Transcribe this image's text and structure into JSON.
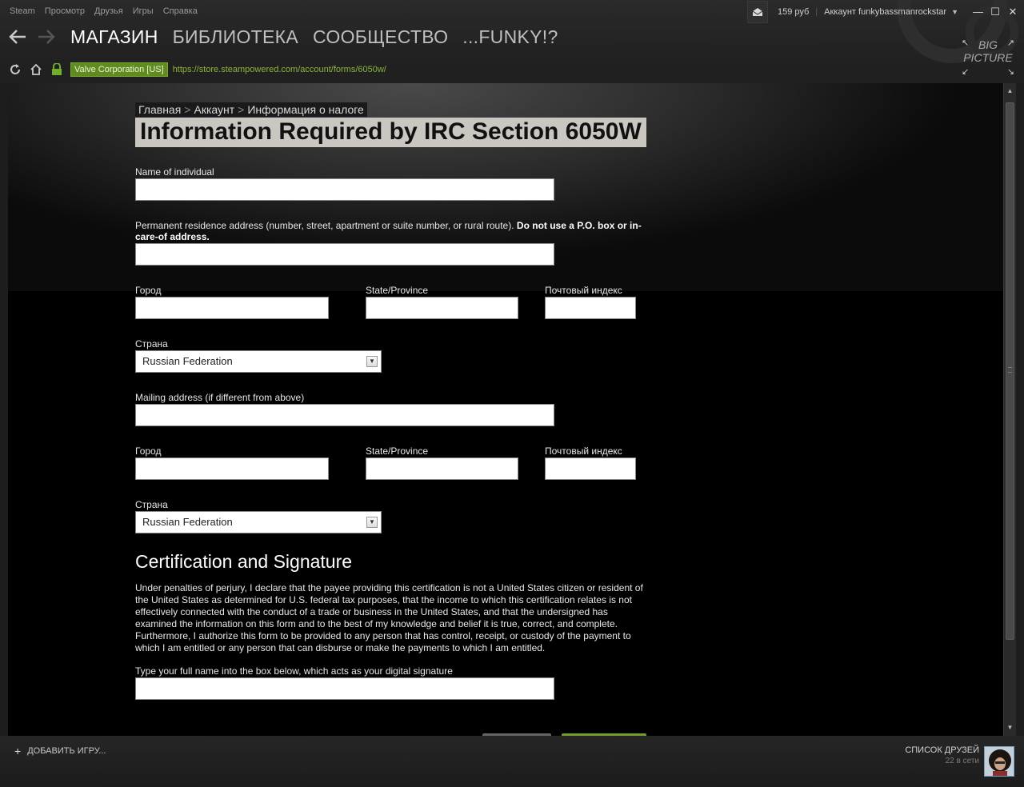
{
  "menu": [
    "Steam",
    "Просмотр",
    "Друзья",
    "Игры",
    "Справка"
  ],
  "wallet": "159 руб",
  "separator": "|",
  "account": "Аккаунт funkybassmanrockstar",
  "nav": [
    "МАГАЗИН",
    "БИБЛИОТЕКА",
    "СООБЩЕСТВО",
    "...FUNKY!?"
  ],
  "big_picture": {
    "line1": "BIG",
    "line2": "PICTURE"
  },
  "ev_badge": "Valve Corporation [US]",
  "url": "https://store.steampowered.com/account/forms/6050w/",
  "breadcrumb": {
    "home": "Главная",
    "account": "Аккаунт",
    "current": "Информация о налоге",
    "sep": ">"
  },
  "title": "Information Required by IRC Section 6050W",
  "fields": {
    "name_label": "Name of individual",
    "address_label": "Permanent residence address (number, street, apartment or suite number, or rural route).",
    "address_bold": "Do not use a P.O. box or in-care-of address.",
    "city_label": "Город",
    "state_label": "State/Province",
    "zip_label": "Почтовый индекс",
    "country_label": "Страна",
    "country_value": "Russian Federation",
    "mailing_label": "Mailing address (if different from above)",
    "city2_label": "Город",
    "state2_label": "State/Province",
    "zip2_label": "Почтовый индекс",
    "country2_label": "Страна",
    "country2_value": "Russian Federation"
  },
  "certification": {
    "heading": "Certification and Signature",
    "text": "Under penalties of perjury, I declare that the payee providing this certification is not a United States citizen or resident of the United States as determined for U.S. federal tax purposes, that the income to which this certification relates is not effectively connected with the conduct of a trade or business in the United States, and that the undersigned has examined the information on this form and to the best of my knowledge and belief it is true, correct, and complete. Furthermore, I authorize this form to be provided to any person that has control, receipt, or custody of the payment to which I am entitled or any person that can disburse or make the payments to which I am entitled.",
    "signature_label": "Type your full name into the box below, which acts as your digital signature"
  },
  "bottom": {
    "add_game": "ДОБАВИТЬ ИГРУ...",
    "friends_title": "СПИСОК ДРУЗЕЙ",
    "friends_online": "22 в сети"
  },
  "colors": {
    "accent_green": "#5f8b21",
    "url_green": "#8ab53b",
    "title_bg": "#c9c7c0"
  }
}
